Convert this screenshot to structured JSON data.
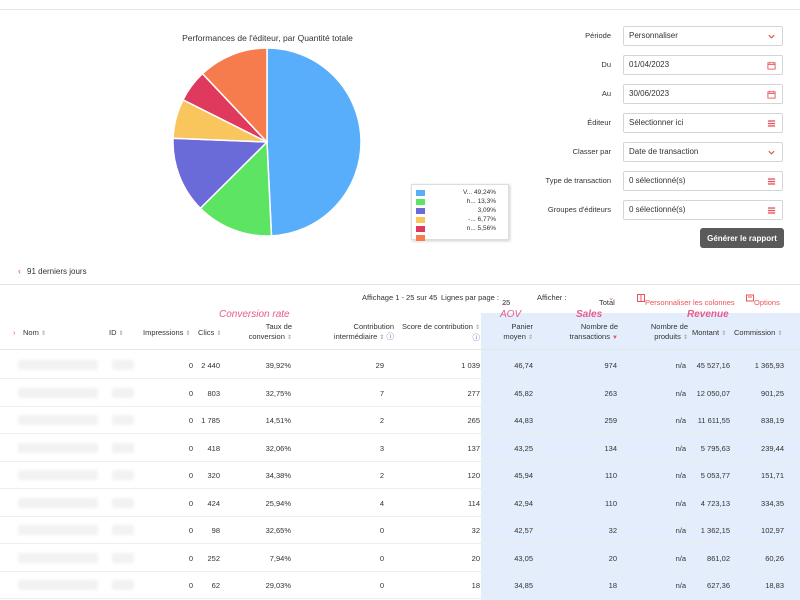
{
  "chart_data": {
    "type": "pie",
    "title": "Performances de l'éditeur, par Quantité totale",
    "series": [
      {
        "name": "V...",
        "value": 49.24,
        "label": "49,24%",
        "color": "#58aefb"
      },
      {
        "name": "h...",
        "value": 13.3,
        "label": "13,3%",
        "color": "#5de463"
      },
      {
        "name": "",
        "value": 13.09,
        "label": "3,09%",
        "color": "#6a6ad9"
      },
      {
        "name": "-...",
        "value": 6.77,
        "label": "6,77%",
        "color": "#f8c65c"
      },
      {
        "name": "n...",
        "value": 5.56,
        "label": "5,56%",
        "color": "#e0395e"
      },
      {
        "name": "",
        "value": 12.04,
        "label": "",
        "color": "#f67c4e"
      }
    ],
    "legend_position": "right"
  },
  "form": {
    "periode": {
      "label": "Période",
      "value": "Personnaliser"
    },
    "du": {
      "label": "Du",
      "value": "01/04/2023"
    },
    "au": {
      "label": "Au",
      "value": "30/06/2023"
    },
    "editeur": {
      "label": "Éditeur",
      "value": "Sélectionner ici"
    },
    "classer": {
      "label": "Classer par",
      "value": "Date de transaction"
    },
    "type_transaction": {
      "label": "Type de transaction",
      "value": "0 sélectionné(s)"
    },
    "groupes": {
      "label": "Groupes d'éditeurs",
      "value": "0 sélectionné(s)"
    },
    "generate_label": "Générer le rapport"
  },
  "back_link": "91 derniers jours",
  "toolbar": {
    "affichage": "Affichage 1 - 25 sur 45",
    "lignes_label": "Lignes par page :",
    "lignes_value": "25",
    "afficher_label": "Afficher :",
    "afficher_value": "Total",
    "personnaliser": "Personnaliser les colonnes",
    "options": "Options"
  },
  "annotations": {
    "conversion": "Conversion rate",
    "aov": "AOV",
    "sales": "Sales",
    "revenue": "Revenue"
  },
  "columns": {
    "nom": "Nom",
    "id": "ID",
    "impressions": "Impressions",
    "clics": "Clics",
    "taux_1": "Taux de",
    "taux_2": "conversion",
    "contrib_1": "Contribution",
    "contrib_2": "intermédiaire",
    "score": "Score de contribution",
    "panier_1": "Panier",
    "panier_2": "moyen",
    "nb_trans_1": "Nombre de",
    "nb_trans_2": "transactions",
    "nb_prod_1": "Nombre de",
    "nb_prod_2": "produits",
    "montant": "Montant",
    "commission": "Commission"
  },
  "rows": [
    {
      "impressions": "0",
      "clics": "2 440",
      "taux": "39,92%",
      "contrib": "29",
      "score": "1 039",
      "panier": "46,74",
      "transactions": "974",
      "produits": "n/a",
      "montant": "45 527,16",
      "commission": "1 365,93"
    },
    {
      "impressions": "0",
      "clics": "803",
      "taux": "32,75%",
      "contrib": "7",
      "score": "277",
      "panier": "45,82",
      "transactions": "263",
      "produits": "n/a",
      "montant": "12 050,07",
      "commission": "901,25"
    },
    {
      "impressions": "0",
      "clics": "1 785",
      "taux": "14,51%",
      "contrib": "2",
      "score": "265",
      "panier": "44,83",
      "transactions": "259",
      "produits": "n/a",
      "montant": "11 611,55",
      "commission": "838,19"
    },
    {
      "impressions": "0",
      "clics": "418",
      "taux": "32,06%",
      "contrib": "3",
      "score": "137",
      "panier": "43,25",
      "transactions": "134",
      "produits": "n/a",
      "montant": "5 795,63",
      "commission": "239,44"
    },
    {
      "impressions": "0",
      "clics": "320",
      "taux": "34,38%",
      "contrib": "2",
      "score": "120",
      "panier": "45,94",
      "transactions": "110",
      "produits": "n/a",
      "montant": "5 053,77",
      "commission": "151,71"
    },
    {
      "impressions": "0",
      "clics": "424",
      "taux": "25,94%",
      "contrib": "4",
      "score": "114",
      "panier": "42,94",
      "transactions": "110",
      "produits": "n/a",
      "montant": "4 723,13",
      "commission": "334,35"
    },
    {
      "impressions": "0",
      "clics": "98",
      "taux": "32,65%",
      "contrib": "0",
      "score": "32",
      "panier": "42,57",
      "transactions": "32",
      "produits": "n/a",
      "montant": "1 362,15",
      "commission": "102,97"
    },
    {
      "impressions": "0",
      "clics": "252",
      "taux": "7,94%",
      "contrib": "0",
      "score": "20",
      "panier": "43,05",
      "transactions": "20",
      "produits": "n/a",
      "montant": "861,02",
      "commission": "60,26"
    },
    {
      "impressions": "0",
      "clics": "62",
      "taux": "29,03%",
      "contrib": "0",
      "score": "18",
      "panier": "34,85",
      "transactions": "18",
      "produits": "n/a",
      "montant": "627,36",
      "commission": "18,83"
    }
  ]
}
